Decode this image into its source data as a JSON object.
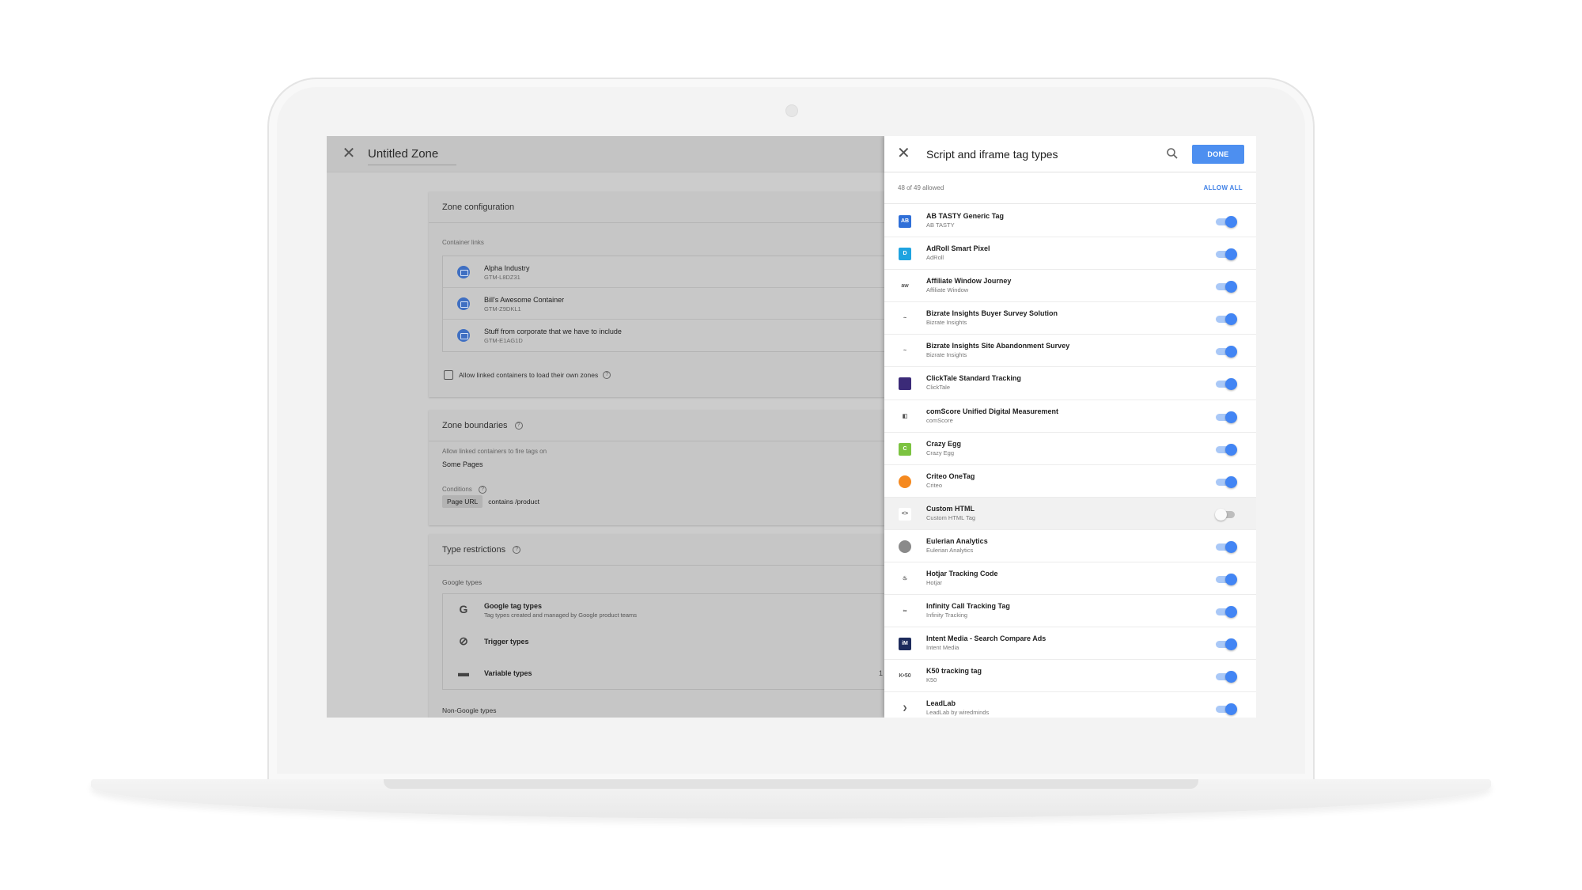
{
  "left": {
    "title": "Untitled Zone",
    "zone_config": {
      "header": "Zone configuration",
      "container_links_label": "Container links",
      "containers": [
        {
          "name": "Alpha Industry",
          "id": "GTM-L8DZ31"
        },
        {
          "name": "Bill's Awesome Container",
          "id": "GTM-Z9DKL1"
        },
        {
          "name": "Stuff from corporate that we have to include",
          "id": "GTM-E1AG1D"
        }
      ],
      "allow_linked_label": "Allow linked containers to load their own zones"
    },
    "zone_boundaries": {
      "header": "Zone boundaries",
      "desc": "Allow linked containers to fire tags on",
      "value": "Some Pages",
      "conditions_label": "Conditions",
      "condition_variable": "Page URL",
      "condition_operator": "contains",
      "condition_value": "/product"
    },
    "type_restrictions": {
      "header": "Type restrictions",
      "google_types_label": "Google types",
      "items": [
        {
          "name": "Google tag types",
          "desc": "Tag types created and managed by Google product teams",
          "icon": "google-g-icon"
        },
        {
          "name": "Trigger types",
          "desc": "",
          "icon": "trigger-icon"
        },
        {
          "name": "Variable types",
          "desc": "",
          "icon": "variable-icon"
        }
      ],
      "variable_suffix": "1",
      "non_google_label": "Non-Google types"
    }
  },
  "panel": {
    "title": "Script and iframe tag types",
    "done_label": "DONE",
    "count_text": "48 of 49 allowed",
    "allow_all_label": "ALLOW ALL",
    "tags": [
      {
        "name": "AB TASTY Generic Tag",
        "vendor": "AB TASTY",
        "icon_color": "#2f6fd8",
        "icon_text": "AB",
        "enabled": true
      },
      {
        "name": "AdRoll Smart Pixel",
        "vendor": "AdRoll",
        "icon_color": "#1fa3e0",
        "icon_text": "D",
        "enabled": true
      },
      {
        "name": "Affiliate Window Journey",
        "vendor": "Affiliate Window",
        "icon_color": "#ffffff",
        "icon_text": "aw",
        "enabled": true
      },
      {
        "name": "Bizrate Insights Buyer Survey Solution",
        "vendor": "Bizrate Insights",
        "icon_color": "#ffffff",
        "icon_text": "~",
        "enabled": true
      },
      {
        "name": "Bizrate Insights Site Abandonment Survey",
        "vendor": "Bizrate Insights",
        "icon_color": "#ffffff",
        "icon_text": "~",
        "enabled": true
      },
      {
        "name": "ClickTale Standard Tracking",
        "vendor": "ClickTale",
        "icon_color": "#3b2a78",
        "icon_text": "",
        "enabled": true
      },
      {
        "name": "comScore Unified Digital Measurement",
        "vendor": "comScore",
        "icon_color": "#ffffff",
        "icon_text": "◧",
        "enabled": true
      },
      {
        "name": "Crazy Egg",
        "vendor": "Crazy Egg",
        "icon_color": "#7cc341",
        "icon_text": "C",
        "enabled": true
      },
      {
        "name": "Criteo OneTag",
        "vendor": "Criteo",
        "icon_color": "#f5891f",
        "icon_text": "",
        "enabled": true
      },
      {
        "name": "Custom HTML",
        "vendor": "Custom HTML Tag",
        "icon_color": "#ffffff",
        "icon_text": "<>",
        "enabled": false
      },
      {
        "name": "Eulerian Analytics",
        "vendor": "Eulerian Analytics",
        "icon_color": "#8a8a8a",
        "icon_text": "",
        "enabled": true
      },
      {
        "name": "Hotjar Tracking Code",
        "vendor": "Hotjar",
        "icon_color": "#ffffff",
        "icon_text": "♨",
        "enabled": true
      },
      {
        "name": "Infinity Call Tracking Tag",
        "vendor": "Infinity Tracking",
        "icon_color": "#ffffff",
        "icon_text": "∞",
        "enabled": true
      },
      {
        "name": "Intent Media - Search Compare Ads",
        "vendor": "Intent Media",
        "icon_color": "#1d2b5c",
        "icon_text": "iM",
        "enabled": true
      },
      {
        "name": "K50 tracking tag",
        "vendor": "K50",
        "icon_color": "#ffffff",
        "icon_text": "K•50",
        "enabled": true
      },
      {
        "name": "LeadLab",
        "vendor": "LeadLab by wiredminds",
        "icon_color": "#ffffff",
        "icon_text": "❯",
        "enabled": true
      }
    ]
  },
  "colors": {
    "accent": "#4285f4",
    "done_button": "#4d8ff0"
  }
}
